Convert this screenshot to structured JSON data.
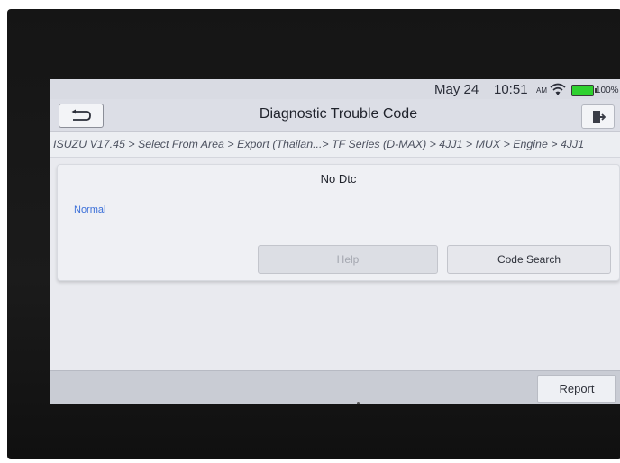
{
  "status_bar": {
    "date": "May 24",
    "time": "10:51",
    "ampm": "AM",
    "battery_text": "100%",
    "battery_level": 1.0,
    "wifi_icon": "wifi-icon"
  },
  "header": {
    "title": "Diagnostic Trouble Code",
    "back_icon": "back-arrow-icon",
    "exit_icon": "exit-icon"
  },
  "breadcrumb": {
    "path": "ISUZU V17.45 > Select From Area > Export (Thailan...> TF Series (D-MAX) > 4JJ1 > MUX > Engine > 4JJ1"
  },
  "result_panel": {
    "title": "No Dtc",
    "status": "Normal",
    "help_label": "Help",
    "code_search_label": "Code Search"
  },
  "footer": {
    "report_label": "Report"
  },
  "colors": {
    "accent_blue": "#3b6fd8",
    "battery_green": "#2fd12f"
  }
}
